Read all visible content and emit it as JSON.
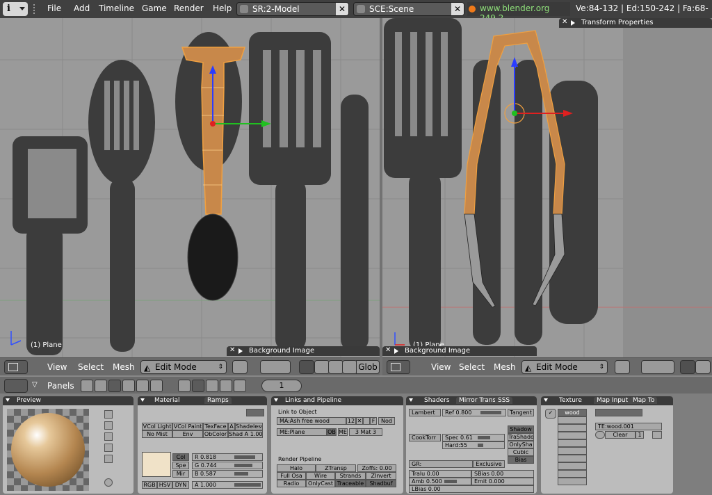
{
  "topbar": {
    "menus": [
      "File",
      "Add",
      "Timeline",
      "Game",
      "Render",
      "Help"
    ],
    "screen_label": "SR:2-Model",
    "scene_label": "SCE:Scene",
    "site_label": "www.blender.org 249.2",
    "stats": "Ve:84-132 | Ed:150-242 | Fa:68-"
  },
  "viewports": {
    "left": {
      "object_label": "(1) Plane",
      "panel_title": "Background Image"
    },
    "right": {
      "object_label": "(1) Plane",
      "panel_title": "Background Image",
      "transform_panel_title": "Transform Properties"
    }
  },
  "vp_header": {
    "menus": [
      "View",
      "Select",
      "Mesh"
    ],
    "mode": "Edit Mode",
    "orientation": "Glob"
  },
  "buttons_window": {
    "panels_label": "Panels",
    "frame": "1",
    "preview": {
      "title": "Preview"
    },
    "material": {
      "tabs": [
        "Material",
        "Ramps"
      ],
      "row1": [
        "VCol Light",
        "VCol Paint",
        "TexFace",
        "Shadeless"
      ],
      "row2": [
        "No Mist",
        "Env",
        "ObColor",
        "Shad A 1.00"
      ],
      "row1_extra": "A",
      "color_buttons": [
        "Col",
        "Spe",
        "Mir"
      ],
      "r": "R 0.818",
      "g": "G 0.744",
      "b": "B 0.587",
      "modes": [
        "RGB",
        "HSV",
        "DYN"
      ],
      "alpha": "A 1.000"
    },
    "links": {
      "tab": "Links and Pipeline",
      "link_to_object": "Link to Object",
      "material_name": "MA:Ash free wood",
      "users": "12",
      "f_btn": "F",
      "nod_btn": "Nod",
      "mesh": "ME:Plane",
      "ob": "OB",
      "me": "ME",
      "mat_index": "3 Mat 3",
      "render_pipeline": "Render Pipeline",
      "rp_row1": [
        "Halo",
        "ZTransp",
        "Zoffs: 0.00"
      ],
      "rp_row2": [
        "Full Osa",
        "Wire",
        "Strands",
        "ZInvert"
      ],
      "rp_row3": [
        "Radio",
        "OnlyCast",
        "Traceable",
        "Shadbuf"
      ]
    },
    "shaders": {
      "tabs": [
        "Shaders",
        "Mirror Trans",
        "SSS"
      ],
      "diffuse": "Lambert",
      "ref": "Ref  0.800",
      "spec_model": "CookTorr",
      "spec": "Spec 0.61",
      "hard": "Hard:55",
      "tangent": "Tangent",
      "shadow": "Shadow",
      "trashado": "TraShado",
      "onlysha": "OnlySha",
      "cubic": "Cubic",
      "bias": "Bias",
      "gr": "GR:",
      "exclusive": "Exclusive",
      "tralu": "Tralu 0.00",
      "sbias": "SBias 0.00",
      "amb": "Amb 0.500",
      "emit": "Emit 0.000",
      "lbias": "LBias 0.00"
    },
    "texture": {
      "tabs": [
        "Texture",
        "Map Input",
        "Map To"
      ],
      "slot": "wood",
      "te_name": "TE:wood.001",
      "clear": "Clear",
      "users": "1"
    }
  }
}
